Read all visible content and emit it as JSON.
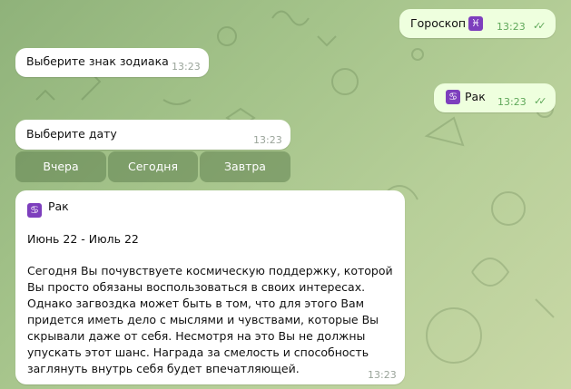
{
  "messages": {
    "horoscope_cmd": {
      "text": "Гороскоп",
      "emoji": "♓",
      "time": "13:23",
      "status": "✓✓"
    },
    "choose_sign": {
      "text": "Выберите знак зодиака",
      "time": "13:23"
    },
    "sign_reply": {
      "emoji": "♋",
      "text": "Рак",
      "time": "13:23",
      "status": "✓✓"
    },
    "choose_date": {
      "text": "Выберите дату",
      "time": "13:23"
    },
    "forecast": {
      "emoji": "♋",
      "sign": "Рак",
      "dates": "Июнь 22 - Июль 22",
      "body": "Сегодня Вы почувствуете космическую поддержку, которой Вы просто обязаны воспользоваться в своих интересах. Однако загвоздка может быть в том, что для этого Вам придется иметь дело с мыслями и чувствами, которые Вы скрывали даже от себя. Несмотря на это Вы не должны упускать этот шанс. Награда за смелость и способность заглянуть внутрь себя будет впечатляющей.",
      "time": "13:23"
    }
  },
  "keyboard": {
    "yesterday": "Вчера",
    "today": "Сегодня",
    "tomorrow": "Завтра"
  },
  "colors": {
    "outgoing_bubble": "#eeffde",
    "incoming_bubble": "#ffffff",
    "zodiac_emoji_bg": "#7d3fbd",
    "read_check": "#5fa85a"
  },
  "icons": [
    "pisces-emoji-icon",
    "cancer-emoji-icon",
    "double-check-icon"
  ]
}
